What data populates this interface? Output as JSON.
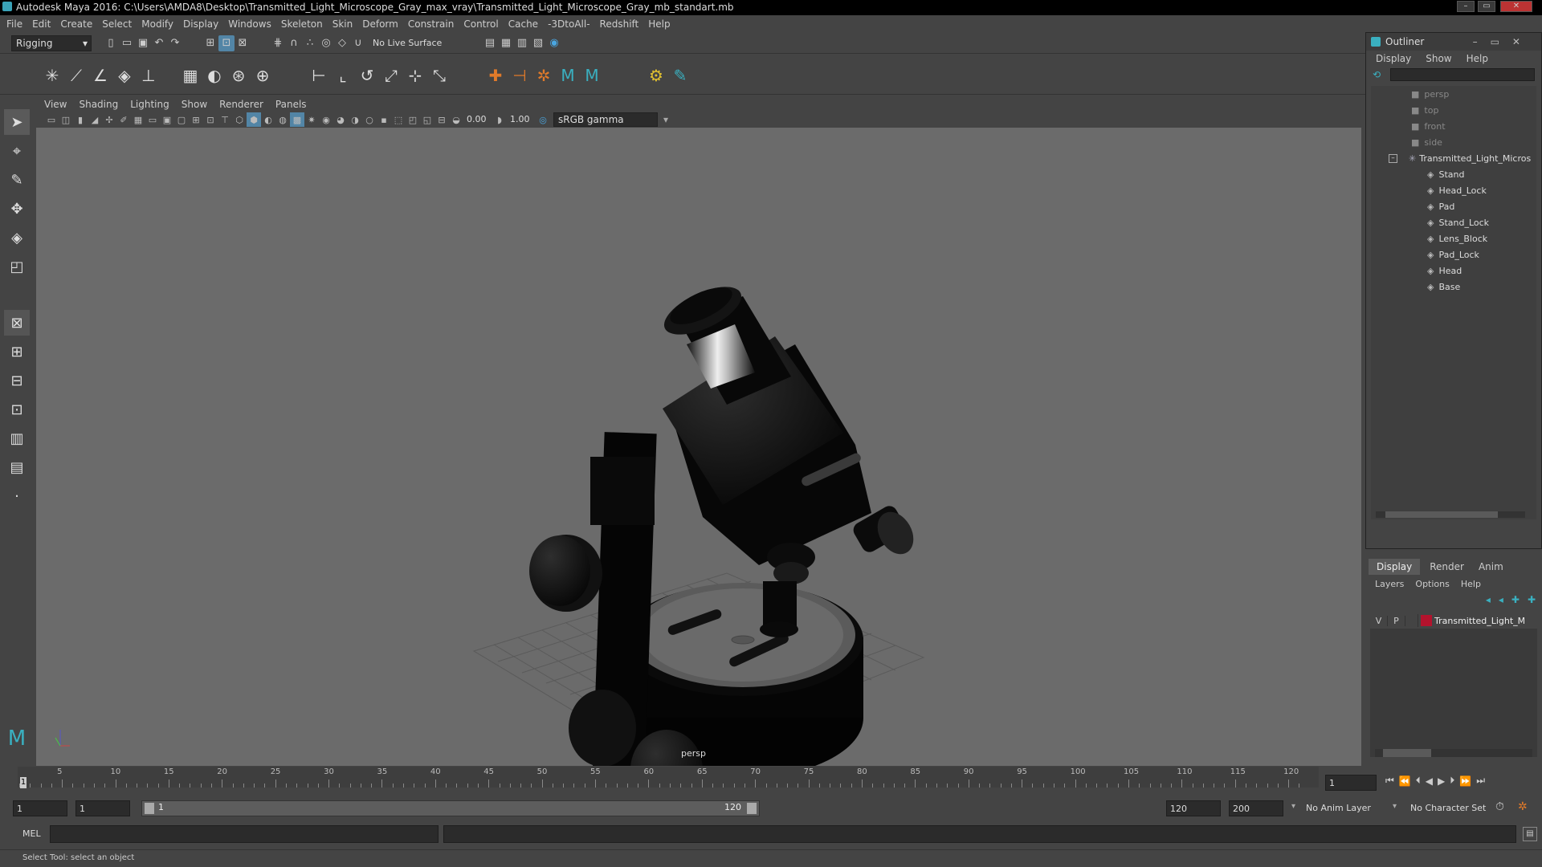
{
  "window": {
    "title": "Autodesk Maya 2016: C:\\Users\\AMDA8\\Desktop\\Transmitted_Light_Microscope_Gray_max_vray\\Transmitted_Light_Microscope_Gray_mb_standart.mb"
  },
  "menubar": [
    "File",
    "Edit",
    "Create",
    "Select",
    "Modify",
    "Display",
    "Windows",
    "Skeleton",
    "Skin",
    "Deform",
    "Constrain",
    "Control",
    "Cache",
    "-3DtoAll-",
    "Redshift",
    "Help"
  ],
  "statusline": {
    "menuset": "Rigging",
    "live_surface": "No Live Surface"
  },
  "panel": {
    "menu": [
      "View",
      "Shading",
      "Lighting",
      "Show",
      "Renderer",
      "Panels"
    ],
    "exposure": "0.00",
    "gamma": "1.00",
    "colorspace": "sRGB gamma",
    "camera_label": "persp"
  },
  "outliner": {
    "title": "Outliner",
    "menu": [
      "Display",
      "Show",
      "Help"
    ],
    "cameras": [
      "persp",
      "top",
      "front",
      "side"
    ],
    "group": "Transmitted_Light_Micros",
    "children": [
      "Stand",
      "Head_Lock",
      "Pad",
      "Stand_Lock",
      "Lens_Block",
      "Pad_Lock",
      "Head",
      "Base"
    ]
  },
  "layer_editor": {
    "tabs": [
      "Display",
      "Render",
      "Anim"
    ],
    "menu": [
      "Layers",
      "Options",
      "Help"
    ],
    "layer": {
      "v": "V",
      "p": "P",
      "name": "Transmitted_Light_Mic",
      "color": "#b3132d"
    }
  },
  "timeline": {
    "ticks": [
      "5",
      "10",
      "15",
      "20",
      "25",
      "30",
      "35",
      "40",
      "45",
      "50",
      "55",
      "60",
      "65",
      "70",
      "75",
      "80",
      "85",
      "90",
      "95",
      "100",
      "105",
      "110",
      "115",
      "120"
    ],
    "marker_start": "1",
    "current_frame": "1"
  },
  "range": {
    "start": "1",
    "playback_start": "1",
    "slider_start": "1",
    "slider_end": "120",
    "playback_end": "120",
    "end": "200",
    "anim_layer": "No Anim Layer",
    "character_set": "No Character Set"
  },
  "cmdline": {
    "label": "MEL"
  },
  "helpline": {
    "text": "Select Tool: select an object"
  },
  "colors": {
    "viewport": "#6b6b6b",
    "ui": "#444444",
    "accent": "#5285a6"
  }
}
